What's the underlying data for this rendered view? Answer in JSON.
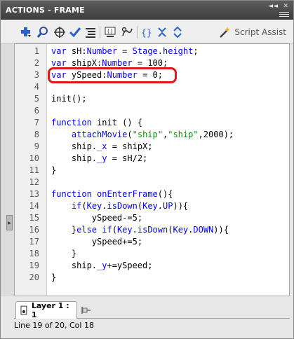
{
  "window": {
    "title": "ACTIONS - FRAME",
    "collapse_glyph": "◄◄",
    "close_glyph": "✕"
  },
  "toolbar": {
    "buttons": [
      {
        "icon": "add-statement-icon",
        "label": "Add a new item to the script"
      },
      {
        "icon": "find-icon",
        "label": "Find"
      },
      {
        "icon": "insert-target-path-icon",
        "label": "Insert a target path"
      },
      {
        "icon": "check-syntax-icon",
        "label": "Check syntax"
      },
      {
        "icon": "auto-format-icon",
        "label": "Auto format"
      },
      {
        "icon": "code-hint-icon",
        "label": "Show code hint"
      },
      {
        "icon": "debug-options-icon",
        "label": "Debug options"
      },
      {
        "icon": "collapse-between-braces-icon",
        "label": "Collapse between braces"
      },
      {
        "icon": "collapse-selection-icon",
        "label": "Collapse selection"
      },
      {
        "icon": "expand-all-icon",
        "label": "Expand all"
      }
    ],
    "script_assist": "Script Assist"
  },
  "editor": {
    "highlighted_line": 3,
    "lines": [
      {
        "n": "1",
        "text": "var sH:Number = Stage.height;"
      },
      {
        "n": "2",
        "text": "var shipX:Number = 100;"
      },
      {
        "n": "3",
        "text": "var ySpeed:Number = 0;"
      },
      {
        "n": "4",
        "text": ""
      },
      {
        "n": "5",
        "text": "init();"
      },
      {
        "n": "6",
        "text": ""
      },
      {
        "n": "7",
        "text": "function init () {"
      },
      {
        "n": "8",
        "text": "    attachMovie(\"ship\",\"ship\",2000);"
      },
      {
        "n": "9",
        "text": "    ship._x = shipX;"
      },
      {
        "n": "10",
        "text": "    ship._y = sH/2;"
      },
      {
        "n": "11",
        "text": "}"
      },
      {
        "n": "12",
        "text": ""
      },
      {
        "n": "13",
        "text": "function onEnterFrame(){"
      },
      {
        "n": "14",
        "text": "    if(Key.isDown(Key.UP)){"
      },
      {
        "n": "15",
        "text": "        ySpeed-=5;"
      },
      {
        "n": "16",
        "text": "    }else if(Key.isDown(Key.DOWN)){"
      },
      {
        "n": "17",
        "text": "        ySpeed+=5;"
      },
      {
        "n": "18",
        "text": "    }"
      },
      {
        "n": "19",
        "text": "    ship._y+=ySpeed;"
      },
      {
        "n": "20",
        "text": "}"
      }
    ]
  },
  "tab": {
    "label": "Layer 1 : 1"
  },
  "status": {
    "text": "Line 19 of 20, Col 18"
  },
  "colors": {
    "keyword": "#0000ff",
    "string": "#009900",
    "highlight_border": "#e01818"
  }
}
